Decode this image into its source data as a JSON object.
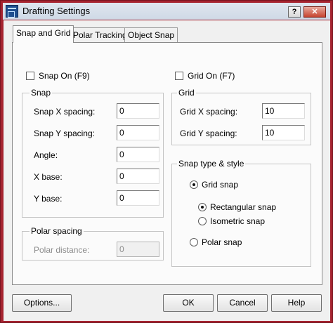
{
  "window": {
    "title": "Drafting Settings",
    "help_glyph": "?",
    "close_glyph": "✕"
  },
  "tabs": [
    {
      "label": "Snap and Grid",
      "active": true
    },
    {
      "label": "Polar Tracking",
      "active": false
    },
    {
      "label": "Object Snap",
      "active": false
    }
  ],
  "snap_on": {
    "label": "Snap On (F9)",
    "checked": false
  },
  "grid_on": {
    "label": "Grid On (F7)",
    "checked": false
  },
  "snap_group": {
    "title": "Snap",
    "fields": [
      {
        "label": "Snap X spacing:",
        "value": "0"
      },
      {
        "label": "Snap Y spacing:",
        "value": "0"
      },
      {
        "label": "Angle:",
        "value": "0"
      },
      {
        "label": "X base:",
        "value": "0"
      },
      {
        "label": "Y base:",
        "value": "0"
      }
    ]
  },
  "polar_group": {
    "title": "Polar spacing",
    "distance_label": "Polar distance:",
    "distance_value": "0",
    "enabled": false
  },
  "grid_group": {
    "title": "Grid",
    "fields": [
      {
        "label": "Grid X spacing:",
        "value": "10"
      },
      {
        "label": "Grid Y spacing:",
        "value": "10"
      }
    ]
  },
  "snap_type_group": {
    "title": "Snap type & style",
    "grid_snap": {
      "label": "Grid snap",
      "selected": true
    },
    "rectangular_snap": {
      "label": "Rectangular snap",
      "selected": true
    },
    "isometric_snap": {
      "label": "Isometric snap",
      "selected": false
    },
    "polar_snap": {
      "label": "Polar snap",
      "selected": false
    }
  },
  "buttons": {
    "options": "Options...",
    "ok": "OK",
    "cancel": "Cancel",
    "help": "Help"
  }
}
